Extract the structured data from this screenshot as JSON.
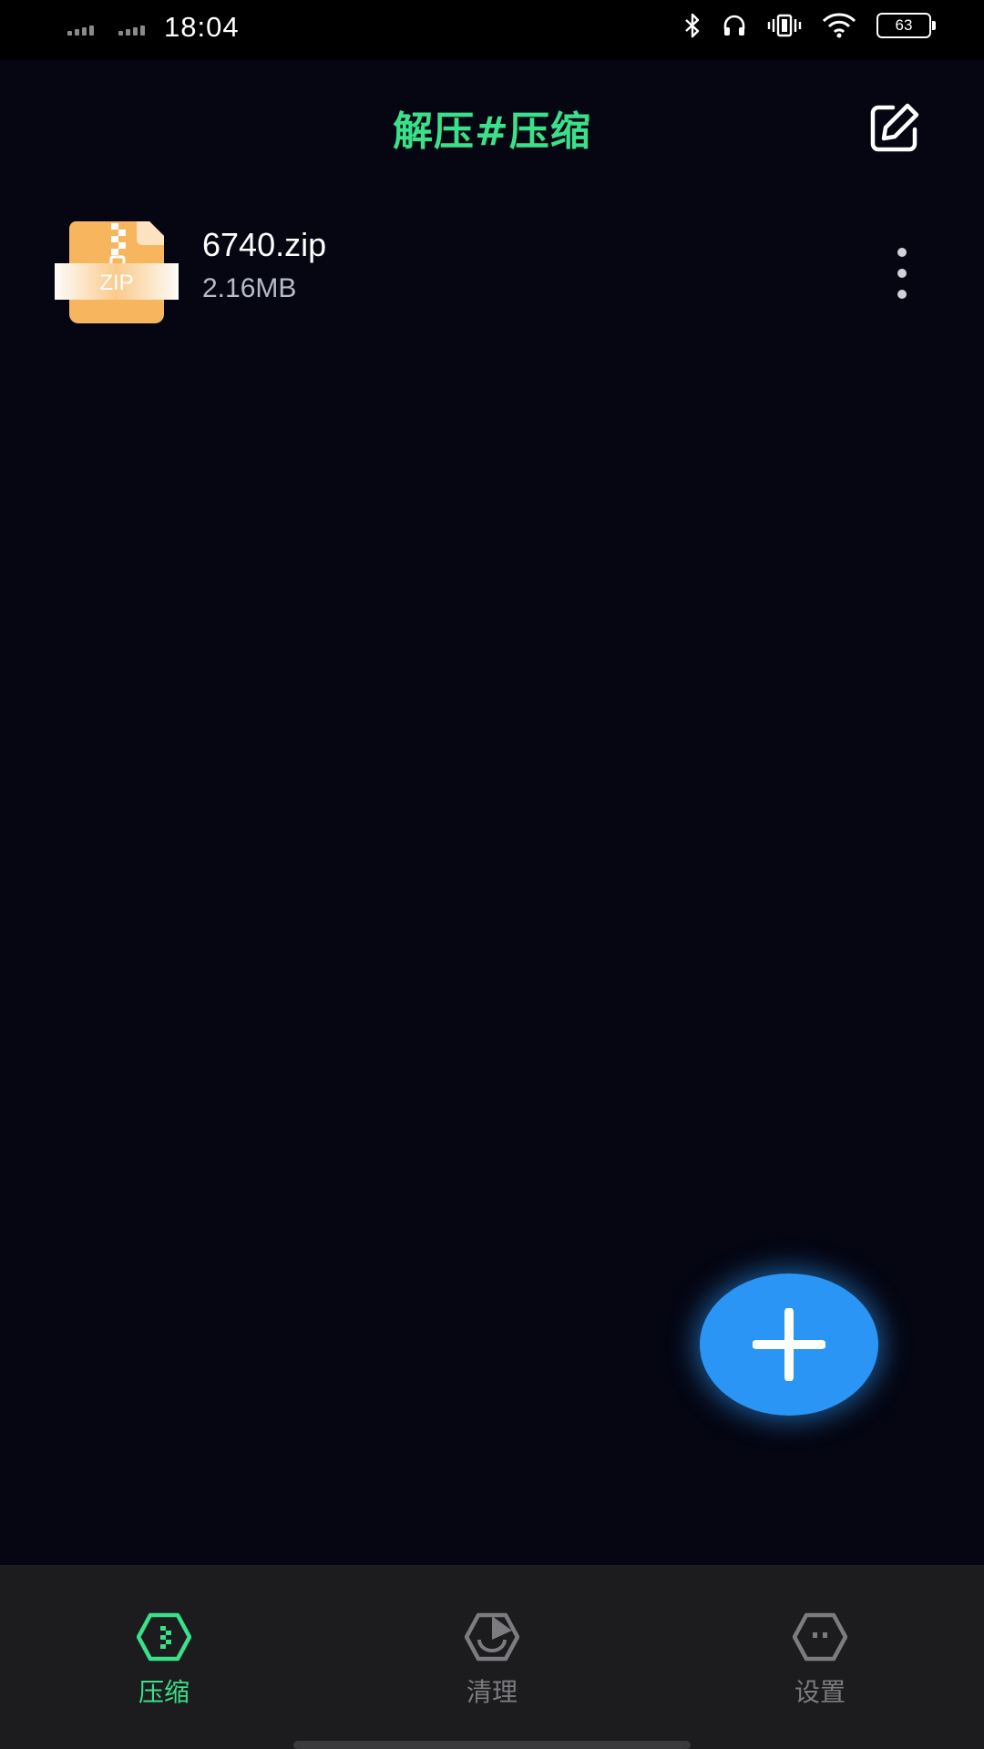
{
  "status_bar": {
    "time": "18:04",
    "battery": "63",
    "icons": [
      "signal-icon",
      "signal-icon",
      "bluetooth-icon",
      "headphones-icon",
      "vibrate-icon",
      "wifi-icon",
      "battery-icon"
    ]
  },
  "header": {
    "title": "解压#压缩",
    "edit_icon": "edit-icon"
  },
  "files": [
    {
      "icon": "zip-file-icon",
      "icon_label": "ZIP",
      "name": "6740.zip",
      "size": "2.16MB",
      "menu_icon": "more-vertical-icon"
    }
  ],
  "fab": {
    "icon": "plus-icon"
  },
  "bottom_nav": {
    "items": [
      {
        "label": "压缩",
        "icon": "compress-icon",
        "active": true
      },
      {
        "label": "清理",
        "icon": "clean-icon",
        "active": false
      },
      {
        "label": "设置",
        "icon": "settings-icon",
        "active": false
      }
    ]
  },
  "colors": {
    "background": "#050612",
    "accent_green": "#3ae08a",
    "fab_blue": "#2a95f4",
    "zip_orange": "#f7b55e",
    "nav_background": "#1c1c1e",
    "nav_inactive": "#7c7c80"
  }
}
